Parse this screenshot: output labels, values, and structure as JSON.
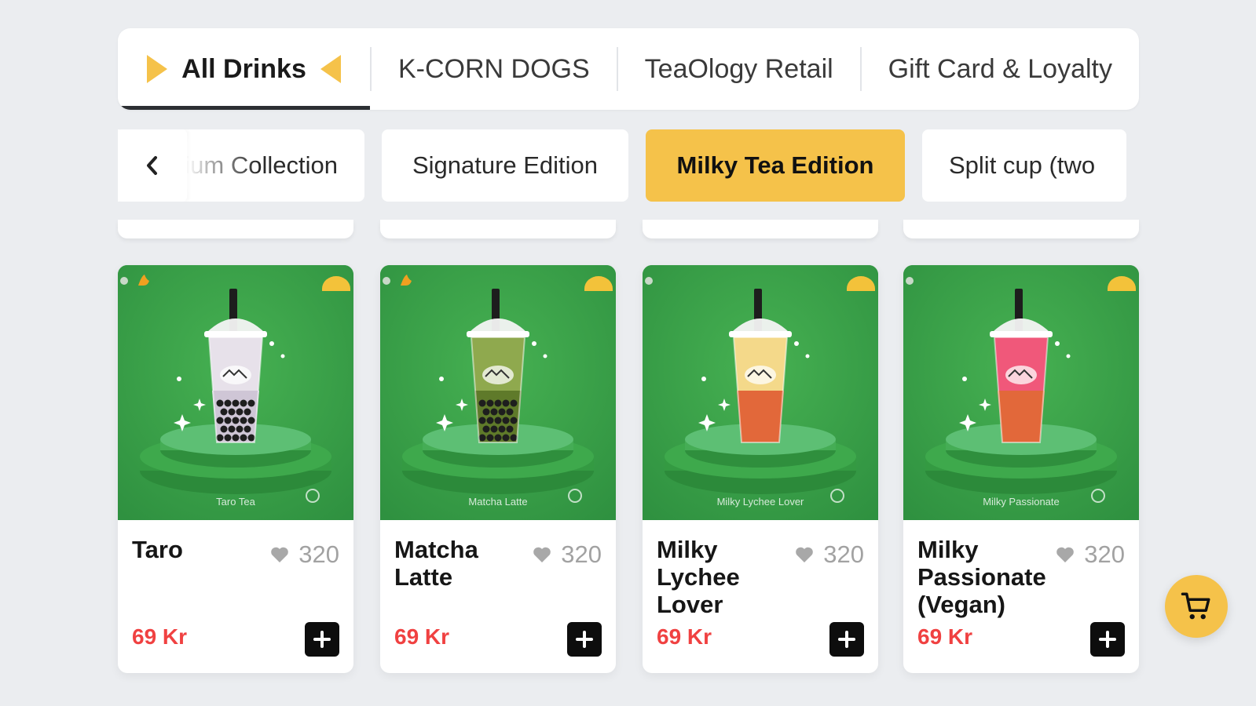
{
  "top_tabs": [
    {
      "label": "All Drinks",
      "active": true
    },
    {
      "label": "K-CORN DOGS",
      "active": false
    },
    {
      "label": "TeaOlogy Retail",
      "active": false
    },
    {
      "label": "Gift Card & Loyalty",
      "active": false
    }
  ],
  "sub_tabs": [
    {
      "label": "Premium Collection",
      "active": false
    },
    {
      "label": "Signature Edition",
      "active": false
    },
    {
      "label": "Milky Tea Edition",
      "active": true
    },
    {
      "label": "Split cup (two",
      "active": false
    }
  ],
  "products": [
    {
      "name": "Taro",
      "likes": "320",
      "price": "69 Kr",
      "image_caption": "Taro Tea",
      "drink_color": "#e7e1ea",
      "layer_color": "#cfc6d6",
      "pearls": true,
      "hot_badge": true
    },
    {
      "name": "Matcha Latte",
      "likes": "320",
      "price": "69 Kr",
      "image_caption": "Matcha Latte",
      "drink_color": "#8fa94e",
      "layer_color": "#5f7a2a",
      "pearls": true,
      "hot_badge": true
    },
    {
      "name": "Milky Lychee Lover",
      "likes": "320",
      "price": "69 Kr",
      "image_caption": "Milky Lychee Lover",
      "drink_color": "#f4d98a",
      "layer_color": "#e2683a",
      "pearls": false,
      "hot_badge": false
    },
    {
      "name": "Milky Passionate (Vegan)",
      "likes": "320",
      "price": "69 Kr",
      "image_caption": "Milky Passionate",
      "drink_color": "#f0587a",
      "layer_color": "#e2683a",
      "pearls": false,
      "hot_badge": false
    }
  ],
  "colors": {
    "accent": "#f5c24a",
    "price": "#f04141",
    "card_image_bg": "#3aa246",
    "page_bg": "#ebedf0"
  },
  "icons": {
    "back": "chevron-left-icon",
    "like": "heart-icon",
    "add": "plus-icon",
    "cart": "cart-icon"
  }
}
